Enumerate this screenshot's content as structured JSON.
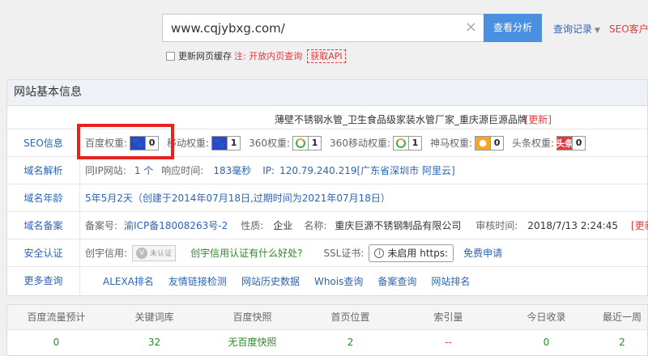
{
  "search": {
    "url": "www.cqjybxg.com/",
    "clear_icon": "×",
    "analyze_label": "查看分析",
    "history_label": "查询记录",
    "client_label": "SEO客户端"
  },
  "options": {
    "refresh_label": "更新网页缓存",
    "note_label": "注: 开放内页查询",
    "api_label": "获取API"
  },
  "panel": {
    "header": "网站基本信息",
    "site_title": "薄壁不锈钢水管_卫生食品级家装水管厂家_重庆源巨源品牌",
    "update_label": "[更新]",
    "seo": {
      "label": "SEO信息",
      "baidu_label": "百度权重:",
      "baidu_value": "0",
      "mobile_label": "移动权重:",
      "mobile_value": "1",
      "s360_label": "360权重:",
      "s360_value": "1",
      "s360m_label": "360移动权重:",
      "s360m_value": "1",
      "shenma_label": "神马权重:",
      "shenma_value": "0",
      "toutiao_label": "头条权重:",
      "toutiao_value": "0",
      "toutiao_badge": "头条"
    },
    "dns": {
      "label": "域名解析",
      "same_ip_label": "同IP网站:",
      "same_ip_value": "1 个",
      "response_label": "响应时间:",
      "response_value": "183毫秒",
      "ip_label": "IP:",
      "ip_value": "120.79.240.219[广东省深圳市 阿里云]"
    },
    "age": {
      "label": "域名年龄",
      "value": "5年5月2天",
      "detail": "（创建于2014年07月18日,过期时间为2021年07月18日）"
    },
    "icp": {
      "label": "域名备案",
      "num_label": "备案号:",
      "num_value": "渝ICP备18008263号-2",
      "nature_label": "性质:",
      "nature_value": "企业",
      "name_label": "名称:",
      "name_value": "重庆巨源不锈钢制品有限公司",
      "time_label": "审核时间:",
      "time_value": "2018/7/13 2:24:45",
      "update_label": "[更新]"
    },
    "security": {
      "label": "安全认证",
      "credit_label": "创宇信用:",
      "unverified_label": "未认证",
      "credit_question": "创宇信用认证有什么好处?",
      "ssl_label": "SSL证书:",
      "https_label": "未启用 https:",
      "apply_label": "免费申请"
    },
    "more": {
      "label": "更多查询",
      "links": [
        "ALEXA排名",
        "友情链接检测",
        "网站历史数据",
        "Whois查询",
        "备案查询",
        "网站排名"
      ]
    }
  },
  "stats": {
    "headers": [
      "百度流量预计",
      "关键词库",
      "百度快照",
      "首页位置",
      "索引量",
      "今日收录",
      "最近一周"
    ],
    "values": [
      "0",
      "32",
      "无百度快照",
      "2",
      "--",
      "0",
      "2"
    ]
  }
}
